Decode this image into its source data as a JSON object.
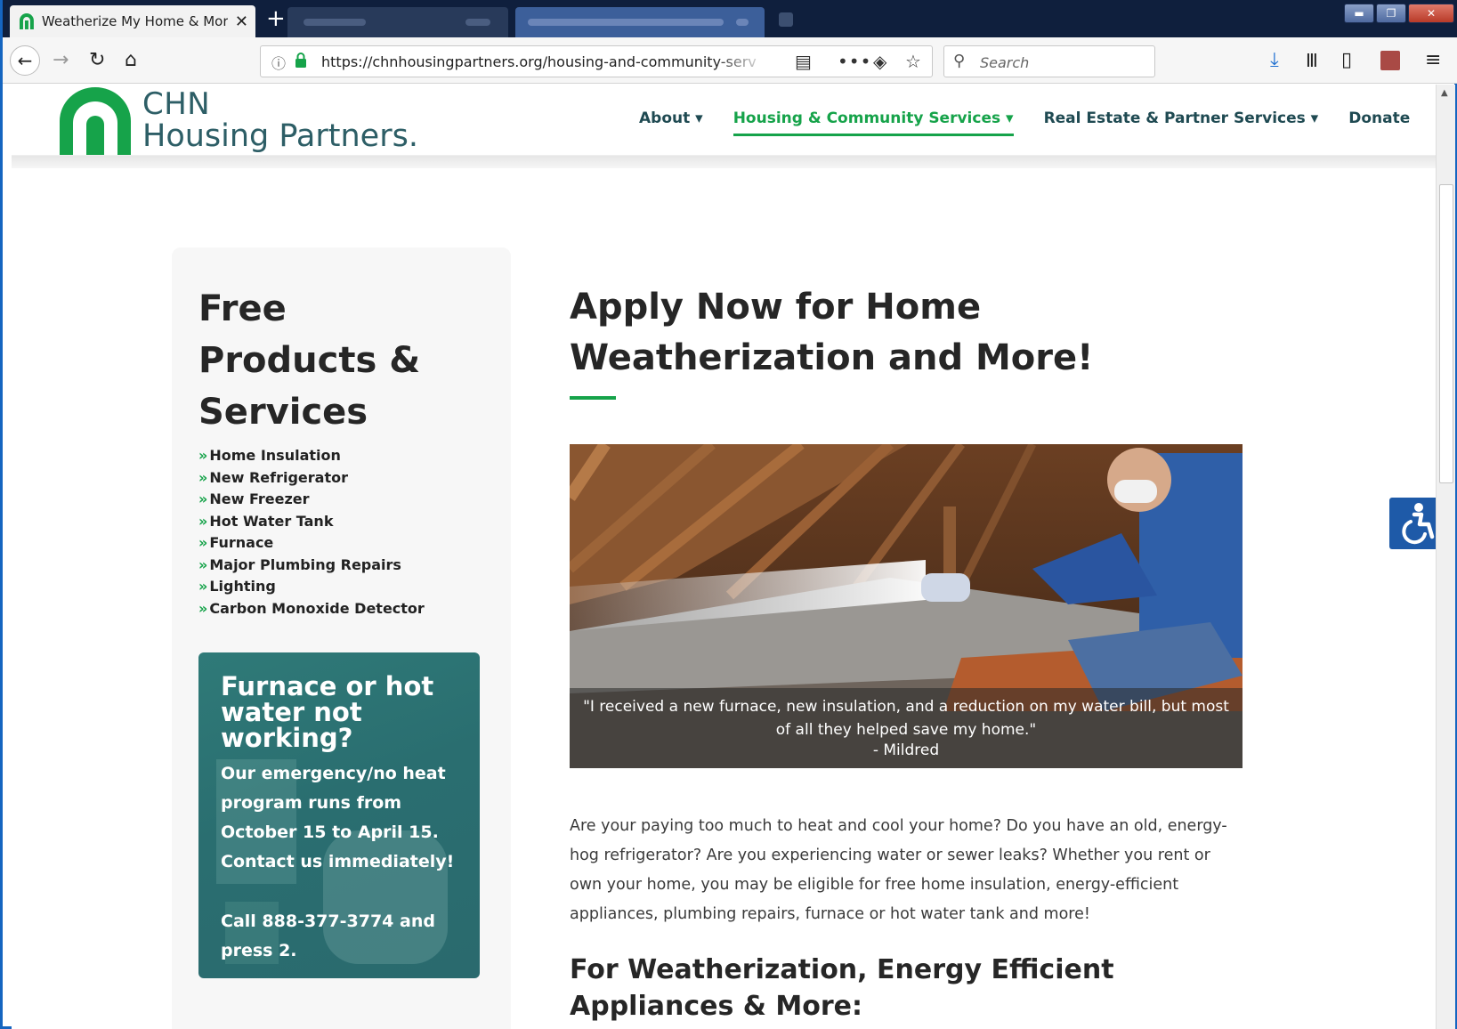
{
  "browser": {
    "tab_active_title": "Weatherize My Home & More | ",
    "tab_close": "✕",
    "new_tab": "+",
    "url": "https://chnhousingpartners.org/housing-and-community-serv",
    "search_placeholder": "Search",
    "window_controls": {
      "minimize": "▬",
      "maximize": "❐",
      "close": "✕"
    }
  },
  "site": {
    "logo": {
      "line1": "CHN",
      "line2": "Housing Partners."
    },
    "nav": [
      {
        "label": "About ▾"
      },
      {
        "label": "Housing & Community Services ▾"
      },
      {
        "label": "Real Estate & Partner Services ▾"
      },
      {
        "label": "Donate"
      }
    ]
  },
  "sidebar": {
    "title": "Free Products & Services",
    "items": [
      "Home Insulation",
      "New Refrigerator",
      "New Freezer",
      "Hot Water Tank",
      "Furnace",
      "Major Plumbing Repairs",
      "Lighting",
      "Carbon Monoxide Detector"
    ],
    "chevron": "»",
    "promo": {
      "heading": "Furnace or hot water not working?",
      "body": "Our emergency/no heat program runs from October 15 to April 15. Contact us immediately!",
      "call": "Call 888-377-3774 and press 2."
    }
  },
  "main": {
    "heading": "Apply Now for Home Weatherization and More!",
    "hero": {
      "quote": "\"I received a new furnace, new insulation, and a reduction on my water bill, but most of all they helped save my home.\"",
      "attribution": "- Mildred"
    },
    "intro": "Are your paying too much to heat and cool your home? Do you have an old, energy-hog refrigerator? Are you experiencing water or sewer leaks? Whether you rent or own your home, you may be eligible for free home insulation, energy-efficient appliances, plumbing repairs, furnace or hot water tank and more!",
    "subheading": "For Weatherization, Energy Efficient Appliances & More:"
  },
  "colors": {
    "brand_green": "#16a34a",
    "brand_teal": "#2d5e66",
    "promo_bg": "#2a6e70",
    "a11y_blue": "#1e5aa8"
  }
}
